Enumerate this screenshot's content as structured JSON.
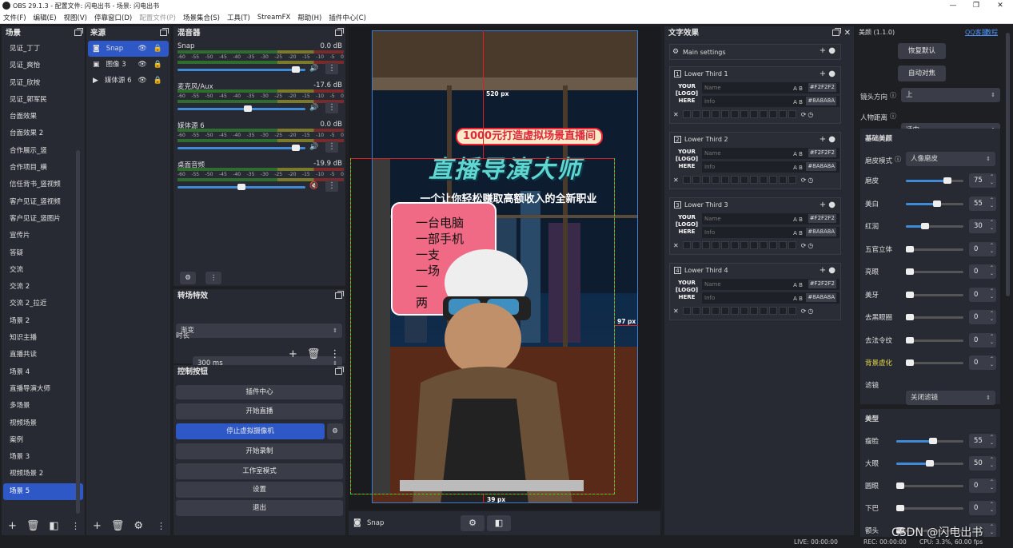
{
  "window": {
    "title": "OBS 29.1.3 - 配置文件: 闪电出书 - 场景: 闪电出书",
    "min": "—",
    "max": "❐",
    "close": "✕"
  },
  "menu": [
    {
      "label": "文件(F)"
    },
    {
      "label": "编辑(E)"
    },
    {
      "label": "视图(V)"
    },
    {
      "label": "停靠窗口(D)"
    },
    {
      "label": "配置文件(P)"
    },
    {
      "label": "场景集合(S)"
    },
    {
      "label": "工具(T)"
    },
    {
      "label": "StreamFX"
    },
    {
      "label": "帮助(H)"
    },
    {
      "label": "插件中心(C)"
    }
  ],
  "scenes": {
    "title": "场景",
    "items": [
      "见证_丁丁",
      "见证_爽怡",
      "见证_欣桉",
      "见证_郭军民",
      "台面效果",
      "台面效果 2",
      "合作展示_竖",
      "合作项目_横",
      "信任背书_竖视频",
      "客户见证_竖视频",
      "客户见证_竖图片",
      "宣传片",
      "答疑",
      "交流",
      "交流 2",
      "交流 2_拉近",
      "场景 2",
      "知识主播",
      "直播共读",
      "场景 4",
      "直播导演大师",
      "多场景",
      "视频场景",
      "案例",
      "场景 3",
      "视频场景 2",
      "场景 5"
    ],
    "selected": "场景 5"
  },
  "sources": {
    "title": "来源",
    "items": [
      {
        "icon": "camera-icon",
        "glyph": "◙",
        "label": "Snap",
        "selected": true
      },
      {
        "icon": "image-icon",
        "glyph": "▣",
        "label": "图像 3",
        "selected": false
      },
      {
        "icon": "play-icon",
        "glyph": "▶",
        "label": "媒体源 6",
        "selected": false
      }
    ]
  },
  "mixer": {
    "title": "混音器",
    "scale": [
      "-60",
      "-55",
      "-50",
      "-45",
      "-40",
      "-35",
      "-30",
      "-25",
      "-20",
      "-15",
      "-10",
      "-5",
      "0"
    ],
    "channels": [
      {
        "name": "Snap",
        "db": "0.0 dB",
        "level": 0.95,
        "muted": false
      },
      {
        "name": "麦克风/Aux",
        "db": "-17.6 dB",
        "level": 0.55,
        "muted": false
      },
      {
        "name": "媒体源 6",
        "db": "0.0 dB",
        "level": 0.95,
        "muted": false
      },
      {
        "name": "桌面音频",
        "db": "-19.9 dB",
        "level": 0.5,
        "muted": true
      }
    ]
  },
  "transitions": {
    "title": "转场特效",
    "type": "渐变",
    "duration_label": "时长",
    "duration": "300 ms"
  },
  "controls": {
    "title": "控制按钮",
    "buttons": [
      "插件中心",
      "开始直播",
      "停止虚拟摄像机",
      "开始录制",
      "工作室模式",
      "设置",
      "退出"
    ]
  },
  "preview": {
    "headline": "直播导演大师",
    "banner": "1000元打造虚拟场景直播间",
    "subtitle": "一个让你轻松赚取高额收入的全新职业",
    "list": [
      "一台电脑",
      "一部手机",
      "一支",
      "一场",
      "一",
      "两"
    ],
    "dim_top": "520 px",
    "dim_right": "97 px",
    "dim_bottom": "39 px",
    "source_label": "Snap"
  },
  "text_effects": {
    "title": "文字效果",
    "main": "Main settings",
    "items": [
      {
        "num": "1",
        "title": "Lower Third 1"
      },
      {
        "num": "2",
        "title": "Lower Third 2"
      },
      {
        "num": "3",
        "title": "Lower Third 3"
      },
      {
        "num": "4",
        "title": "Lower Third 4"
      }
    ],
    "logo": "YOUR\n[LOGO]\nHERE",
    "name_ph": "Name",
    "info_ph": "Info",
    "color1": "#F2F2F2",
    "color2": "#8A8A8A",
    "ab": "A B"
  },
  "beauty": {
    "title": "美颜 (1.1.0)",
    "qq": "QQ客服",
    "tutorial": "教程",
    "reset": "恢复默认",
    "auto": "自动对焦",
    "dir_label": "镜头方向",
    "dir": "上",
    "dist_label": "人物距离",
    "dist": "适中",
    "basic_title": "基础美颜",
    "mode_label": "磨皮模式",
    "mode": "人像磨皮",
    "sliders": [
      {
        "label": "磨皮",
        "value": 75
      },
      {
        "label": "美白",
        "value": 55
      },
      {
        "label": "红润",
        "value": 30
      },
      {
        "label": "五官立体",
        "value": 0
      },
      {
        "label": "亮眼",
        "value": 0
      },
      {
        "label": "美牙",
        "value": 0
      },
      {
        "label": "去黑眼圈",
        "value": 0
      },
      {
        "label": "去法令纹",
        "value": 0
      },
      {
        "label": "背景虚化",
        "value": 0
      }
    ],
    "filter_label": "滤镜",
    "filter": "关闭滤镜",
    "shape_title": "美型",
    "shape": [
      {
        "label": "瘦脸",
        "value": 55
      },
      {
        "label": "大眼",
        "value": 50
      },
      {
        "label": "圆眼",
        "value": 0
      },
      {
        "label": "下巴",
        "value": 0
      },
      {
        "label": "额头",
        "value": ""
      }
    ]
  },
  "status": {
    "live": "LIVE: 00:00:00",
    "rec": "REC: 00:00:00",
    "cpu": "CPU: 3.3%, 60.00 fps",
    "watermark": "CSDN @闪电出书"
  }
}
